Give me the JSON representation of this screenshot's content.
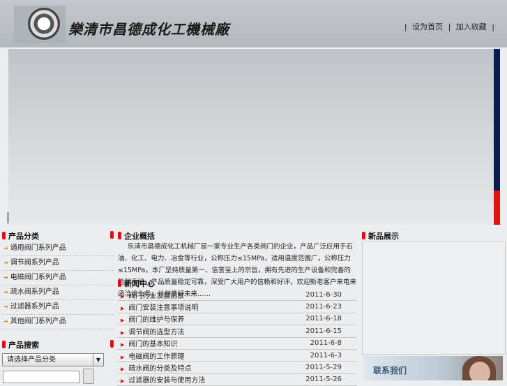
{
  "header": {
    "company_name": "樂清市昌德成化工機械廠",
    "links": [
      "|",
      "设为首页",
      "|",
      "加入收藏",
      "|"
    ]
  },
  "categories": {
    "title": "产品分类",
    "items": [
      "通用阀门系列产品",
      "调节阀系列产品",
      "电磁阀门系列产品",
      "疏水阀系列产品",
      "过滤器系列产品",
      "其他阀门系列产品"
    ]
  },
  "search": {
    "title": "产品搜索",
    "select_value": "请选择产品分类"
  },
  "about": {
    "title": "企业概括",
    "text": "乐清市昌德成化工机械厂是一家专业生产各类阀门的企业，产品广泛应用于石油、化工、电力、冶金等行业，公称压力≤15MPa，适用温度范围广，公称压力≤15MPa，本厂坚持质量第一、信誉至上的宗旨，拥有先进的生产设备和完善的检测手段，产品质量稳定可靠，深受广大用户的信赖和好评，欢迎新老客户来电来函洽谈业务，共创美好未来……"
  },
  "news": {
    "title": "新闻中心",
    "items": [
      {
        "title": "阀门行业发展前景",
        "date": "2011-6-30"
      },
      {
        "title": "阀门安装注意事项说明",
        "date": "2011-6-23"
      },
      {
        "title": "阀门的维护与保养",
        "date": "2011-6-18"
      },
      {
        "title": "调节阀的选型方法",
        "date": "2011-6-15"
      },
      {
        "title": "阀门的基本知识",
        "date": "2011-6-8"
      },
      {
        "title": "电磁阀的工作原理",
        "date": "2011-6-3"
      },
      {
        "title": "疏水阀的分类及特点",
        "date": "2011-5-29"
      },
      {
        "title": "过滤器的安装与使用方法",
        "date": "2011-5-26"
      }
    ]
  },
  "new_products": {
    "title": "新品展示"
  },
  "contact": {
    "label": "联系我们"
  },
  "colors": {
    "accent_red": "#e31212",
    "banner_blue": "#0c1c52"
  }
}
